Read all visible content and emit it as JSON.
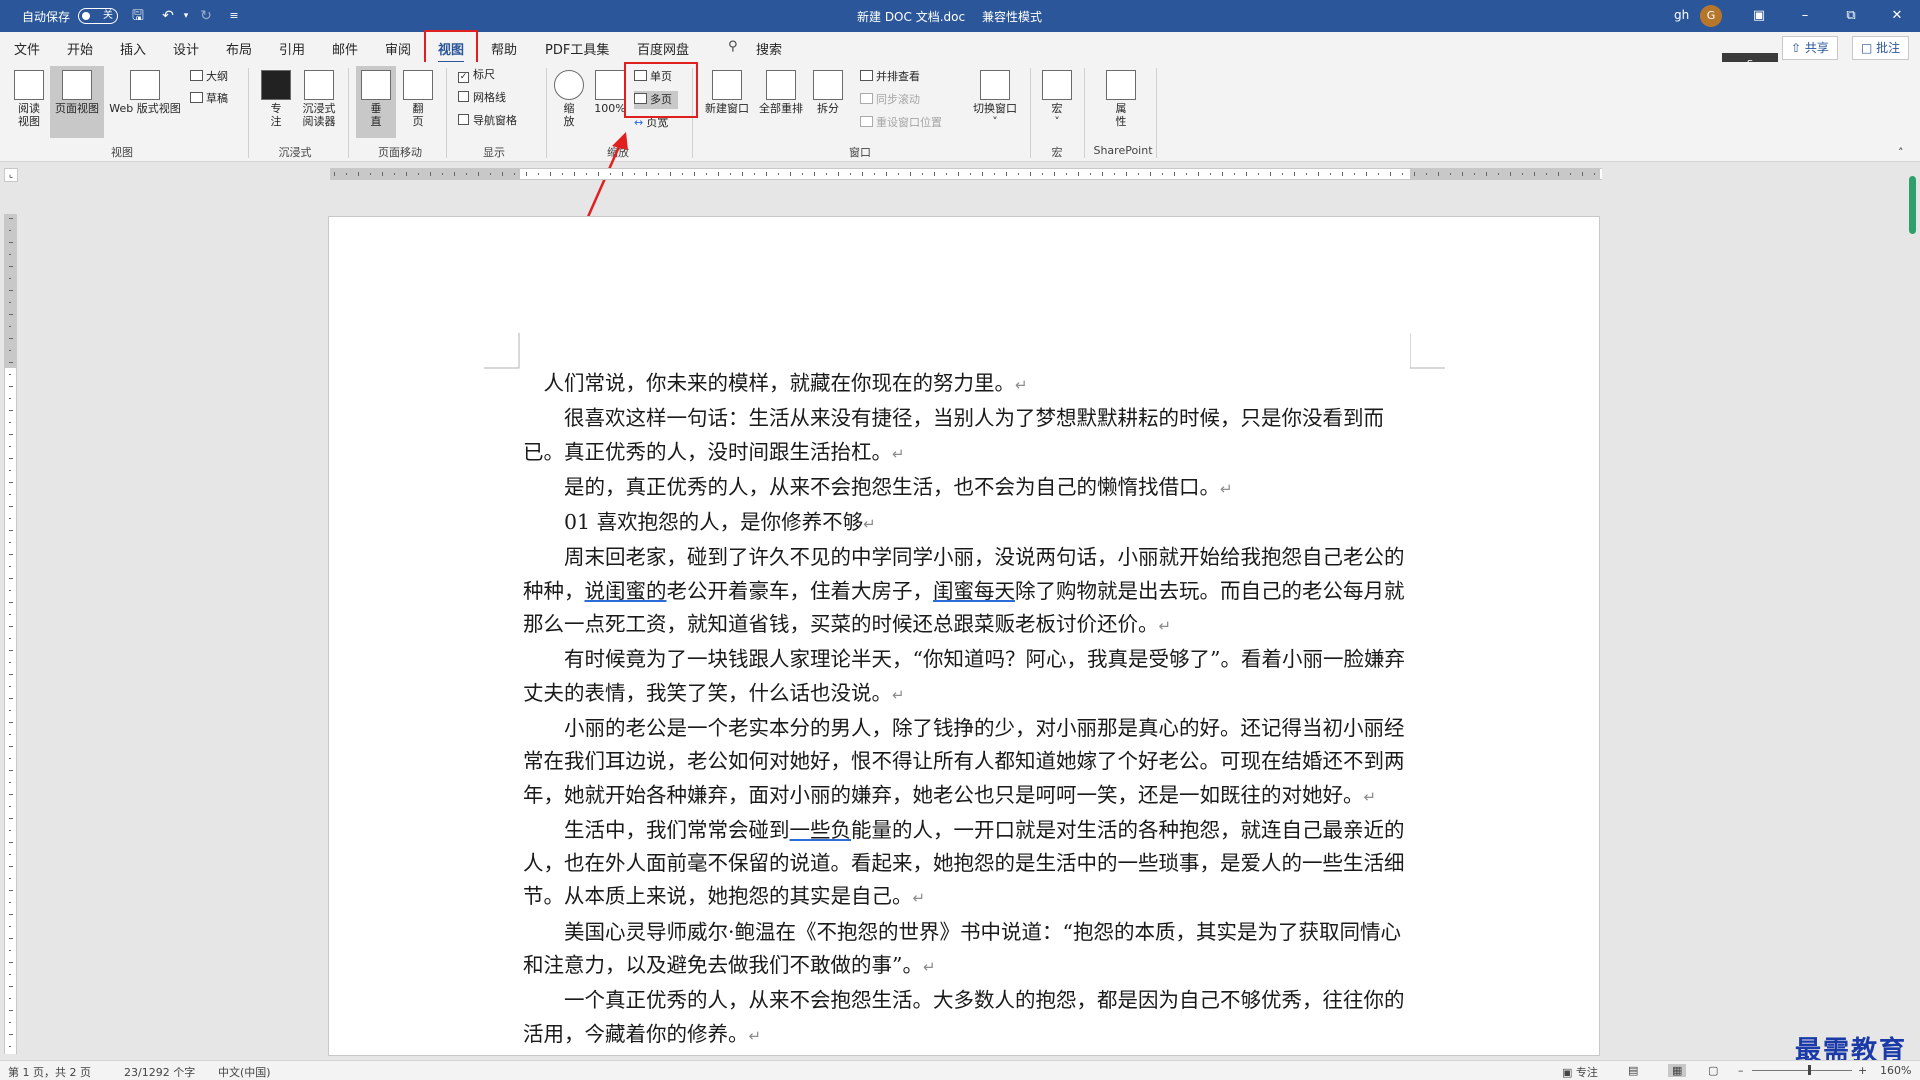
{
  "titlebar": {
    "autosave_label": "自动保存",
    "autosave_state": "关",
    "document_title": "新建 DOC 文档.doc",
    "mode": "兼容性模式",
    "user": "gh",
    "avatar_initial": "G"
  },
  "tabs": [
    "文件",
    "开始",
    "插入",
    "设计",
    "布局",
    "引用",
    "邮件",
    "审阅",
    "视图",
    "帮助",
    "PDF工具集",
    "百度网盘"
  ],
  "active_tab": "视图",
  "search_label": "搜索",
  "share_label": "共享",
  "comment_label": "批注",
  "ribbon": {
    "views": {
      "read_mode": "阅读\n视图",
      "print_layout": "页面视图",
      "web_layout": "Web 版式视图",
      "outline": "大纲",
      "draft": "草稿",
      "group": "视图"
    },
    "immersive": {
      "focus": "专\n注",
      "reader": "沉浸式\n阅读器",
      "group": "沉浸式"
    },
    "page_movement": {
      "vertical": "垂\n直",
      "side": "翻\n页",
      "group": "页面移动"
    },
    "show": {
      "ruler": "标尺",
      "gridlines": "网格线",
      "nav_pane": "导航窗格",
      "group": "显示"
    },
    "zoom": {
      "zoom": "缩\n放",
      "hundred": "100%",
      "one_page": "单页",
      "multi_page": "多页",
      "page_width": "页宽",
      "group": "缩放"
    },
    "window": {
      "new_window": "新建窗口",
      "arrange_all": "全部重排",
      "split": "拆分",
      "side_by_side": "并排查看",
      "sync_scroll": "同步滚动",
      "reset_pos": "重设窗口位置",
      "switch": "切换窗口",
      "group": "窗口"
    },
    "macros": {
      "macros": "宏",
      "group": "宏"
    },
    "sharepoint": {
      "properties": "属\n性",
      "group": "SharePoint"
    }
  },
  "document": {
    "paragraphs": [
      {
        "cls": "first",
        "segments": [
          {
            "t": "人们常说，你未来的模样，就藏在你现在的努力里。"
          }
        ]
      },
      {
        "cls": "",
        "segments": [
          {
            "t": "很喜欢这样一句话：生活从来没有捷径，当别人为了梦想默默耕耘的时候，只是你没看到而已。真正优秀的人，没时间跟生活抬杠。"
          }
        ]
      },
      {
        "cls": "",
        "segments": [
          {
            "t": "是的，真正优秀的人，从来不会抱怨生活，也不会为自己的懒惰找借口。"
          }
        ]
      },
      {
        "cls": "",
        "segments": [
          {
            "t": "01 喜欢抱怨的人，是你修养不够"
          }
        ]
      },
      {
        "cls": "",
        "segments": [
          {
            "t": "周末回老家，碰到了许久不见的中学同学小丽，没说两句话，小丽就开始给我抱怨自己老公的种种，"
          },
          {
            "t": "说闺蜜的",
            "ul": true
          },
          {
            "t": "老公开着豪车，住着大房子，"
          },
          {
            "t": "闺蜜每天",
            "ul": true
          },
          {
            "t": "除了购物就是出去玩。而自己的老公每月就那么一点死工资，就知道省钱，买菜的时候还总跟菜贩老板讨价还价。"
          }
        ]
      },
      {
        "cls": "",
        "segments": [
          {
            "t": "有时候竟为了一块钱跟人家理论半天，“你知道吗？阿心，我真是受够了”。看着小丽一脸嫌弃丈夫的表情，我笑了笑，什么话也没说。"
          }
        ]
      },
      {
        "cls": "",
        "segments": [
          {
            "t": "小丽的老公是一个老实本分的男人，除了钱挣的少，对小丽那是真心的好。还记得当初小丽经常在我们耳边说，老公如何对她好，恨不得让所有人都知道她嫁了个好老公。可现在结婚还不到两年，她就开始各种嫌弃，面对小丽的嫌弃，她老公也只是呵呵一笑，还是一如既往的对她好。"
          }
        ]
      },
      {
        "cls": "",
        "segments": [
          {
            "t": "生活中，我们常常会碰到"
          },
          {
            "t": "一些负",
            "ul": true
          },
          {
            "t": "能量的人，一开口就是对生活的各种抱怨，就连自己最亲近的人，也在外人面前毫不保留的说道。看起来，她抱怨的是生活中的一些琐事，是爱人的一些生活细节。从本质上来说，她抱怨的其实是自己。"
          }
        ]
      },
      {
        "cls": "",
        "segments": [
          {
            "t": "美国心灵导师威尔·鲍温在《不抱怨的世界》书中说道：“抱怨的本质，其实是为了获取同情心和注意力，以及避免去做我们不敢做的事”。"
          }
        ]
      },
      {
        "cls": "",
        "segments": [
          {
            "t": "一个真正优秀的人，从来不会抱怨生活。大多数人的抱怨，都是因为自己不够优秀，往往你的活用，今藏着你的修养。"
          }
        ]
      }
    ]
  },
  "status": {
    "page": "第 1 页，共 2 页",
    "words": "23/1292 个字",
    "language": "中文(中国)",
    "focus": "专注",
    "zoom": "160%"
  },
  "watermark": "最需教育",
  "colors": {
    "accent": "#2b579a",
    "highlight_box": "#e0201f",
    "scroll_thumb": "#2fa06b"
  }
}
